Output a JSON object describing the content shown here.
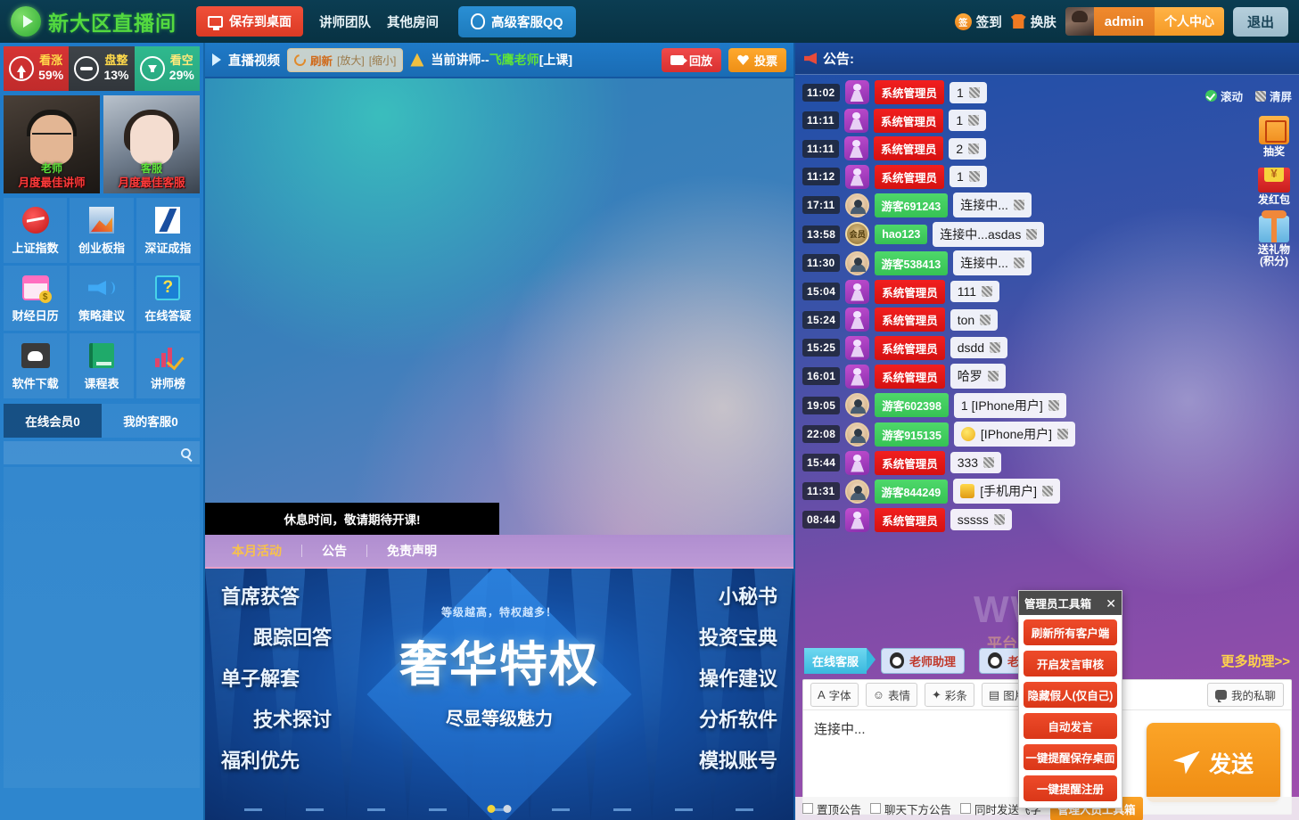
{
  "header": {
    "logo_text": "新大区直播间",
    "save_desktop": "保存到桌面",
    "links": [
      "讲师团队",
      "其他房间"
    ],
    "qq_button": "高级客服QQ",
    "sign_in": "签到",
    "sign_badge": "签",
    "skin": "换肤",
    "username": "admin",
    "user_center": "个人中心",
    "logout": "退出"
  },
  "sidebar": {
    "sentiment": [
      {
        "label": "看涨",
        "pct": "59%"
      },
      {
        "label": "盘整",
        "pct": "13%"
      },
      {
        "label": "看空",
        "pct": "29%"
      }
    ],
    "teachers": [
      {
        "caption": "月度最佳讲师",
        "overlay": "老师"
      },
      {
        "caption": "月度最佳客服",
        "overlay": "客服"
      }
    ],
    "tiles": [
      {
        "label": "上证指数",
        "icon": "sse-index-icon"
      },
      {
        "label": "创业板指",
        "icon": "chinext-index-icon"
      },
      {
        "label": "深证成指",
        "icon": "szse-index-icon"
      },
      {
        "label": "财经日历",
        "icon": "calendar-icon"
      },
      {
        "label": "策略建议",
        "icon": "megaphone-icon"
      },
      {
        "label": "在线答疑",
        "icon": "question-icon"
      },
      {
        "label": "软件下载",
        "icon": "download-icon"
      },
      {
        "label": "课程表",
        "icon": "book-icon"
      },
      {
        "label": "讲师榜",
        "icon": "ranking-icon"
      }
    ],
    "tabs": [
      {
        "label": "在线会员0",
        "active": true
      },
      {
        "label": "我的客服0",
        "active": false
      }
    ],
    "search_placeholder": ""
  },
  "video": {
    "title": "直播视频",
    "refresh": "刷新",
    "zoom_in": "[放大]",
    "zoom_out": "[缩小]",
    "teacher_prefix": "当前讲师--",
    "teacher_name": "飞鹰老师",
    "teacher_suffix": "[上课]",
    "replay": "回放",
    "vote": "投票",
    "status_msg": "休息时间，敬请期待开课!"
  },
  "promo": {
    "tabs": [
      {
        "label": "本月活动",
        "active": true
      },
      {
        "label": "公告",
        "active": false
      },
      {
        "label": "免责声明",
        "active": false
      }
    ],
    "banner": {
      "subtitle": "等级越高，特权越多！",
      "title": "奢华特权",
      "tagline": "尽显等级魅力",
      "left_items": [
        "首席获答",
        "跟踪回答",
        "单子解套",
        "技术探讨",
        "福利优先"
      ],
      "right_items": [
        "小秘书",
        "投资宝典",
        "操作建议",
        "分析软件",
        "模拟账号"
      ],
      "dots": [
        {
          "active": true
        },
        {
          "active": false
        }
      ]
    }
  },
  "chat": {
    "panel_title": "公告:",
    "controls": [
      {
        "label": "滚动",
        "icon": "check-circle-icon"
      },
      {
        "label": "清屏",
        "icon": "clear-screen-icon"
      }
    ],
    "side_icons": [
      {
        "label": "抽奖",
        "icon": "lottery-box-icon"
      },
      {
        "label": "发红包",
        "icon": "red-packet-icon"
      },
      {
        "label": "送礼物\n(积分)",
        "icon": "gift-icon"
      }
    ],
    "messages": [
      {
        "time": "11:02",
        "avatar": "admin",
        "name": "系统管理员",
        "name_type": "red",
        "text": "1"
      },
      {
        "time": "11:11",
        "avatar": "admin",
        "name": "系统管理员",
        "name_type": "red",
        "text": "1"
      },
      {
        "time": "11:11",
        "avatar": "admin",
        "name": "系统管理员",
        "name_type": "red",
        "text": "2"
      },
      {
        "time": "11:12",
        "avatar": "admin",
        "name": "系统管理员",
        "name_type": "red",
        "text": "1"
      },
      {
        "time": "17:11",
        "avatar": "guest",
        "name": "游客691243",
        "name_type": "green",
        "text": "连接中..."
      },
      {
        "time": "13:58",
        "avatar": "vip",
        "name": "hao123",
        "name_type": "green",
        "text": "连接中...asdas"
      },
      {
        "time": "11:30",
        "avatar": "guest",
        "name": "游客538413",
        "name_type": "green",
        "text": "连接中..."
      },
      {
        "time": "15:04",
        "avatar": "admin",
        "name": "系统管理员",
        "name_type": "red",
        "text": "111"
      },
      {
        "time": "15:24",
        "avatar": "admin",
        "name": "系统管理员",
        "name_type": "red",
        "text": "ton"
      },
      {
        "time": "15:25",
        "avatar": "admin",
        "name": "系统管理员",
        "name_type": "red",
        "text": "dsdd"
      },
      {
        "time": "16:01",
        "avatar": "admin",
        "name": "系统管理员",
        "name_type": "red",
        "text": "哈罗"
      },
      {
        "time": "19:05",
        "avatar": "guest",
        "name": "游客602398",
        "name_type": "green",
        "text": "1 [IPhone用户]"
      },
      {
        "time": "22:08",
        "avatar": "guest",
        "name": "游客915135",
        "name_type": "green",
        "text": "[IPhone用户]",
        "emoji": "smile"
      },
      {
        "time": "15:44",
        "avatar": "admin",
        "name": "系统管理员",
        "name_type": "red",
        "text": "333"
      },
      {
        "time": "11:31",
        "avatar": "guest",
        "name": "游客844249",
        "name_type": "green",
        "text": "[手机用户]",
        "emoji": "packet"
      },
      {
        "time": "08:44",
        "avatar": "admin",
        "name": "系统管理员",
        "name_type": "red",
        "text": "sssss"
      }
    ],
    "vip_badge": "会员"
  },
  "toolbox": {
    "title": "管理员工具箱",
    "close": "✕",
    "buttons": [
      "刷新所有客户端",
      "开启发言审核",
      "隐藏假人(仅自己)",
      "自动发言",
      "一键提醒保存桌面",
      "一键提醒注册"
    ]
  },
  "watermark": {
    "text": "WWW.C",
    "sub": "平台"
  },
  "service": {
    "tag": "在线客服",
    "buttons": [
      "老师助理",
      "老师助理"
    ],
    "more": "更多助理>>"
  },
  "input": {
    "tools": [
      {
        "label": "字体",
        "icon": "font-icon",
        "glyph": "A"
      },
      {
        "label": "表情",
        "icon": "emoji-icon",
        "glyph": "☺"
      },
      {
        "label": "彩条",
        "icon": "colorbar-icon",
        "glyph": "✦"
      },
      {
        "label": "图片",
        "icon": "image-icon",
        "glyph": "▤"
      }
    ],
    "my_chat": "我的私聊",
    "value": "连接中...",
    "placeholder": "",
    "send": "发送",
    "footer_checks": [
      "置顶公告",
      "聊天下方公告",
      "同时发送飞字"
    ],
    "footer_button": "管理人员工具箱"
  },
  "colors": {
    "accent_orange": "#ef8c12",
    "accent_red": "#d93030",
    "accent_green": "#53d93f",
    "accent_blue": "#1f7ac8"
  }
}
